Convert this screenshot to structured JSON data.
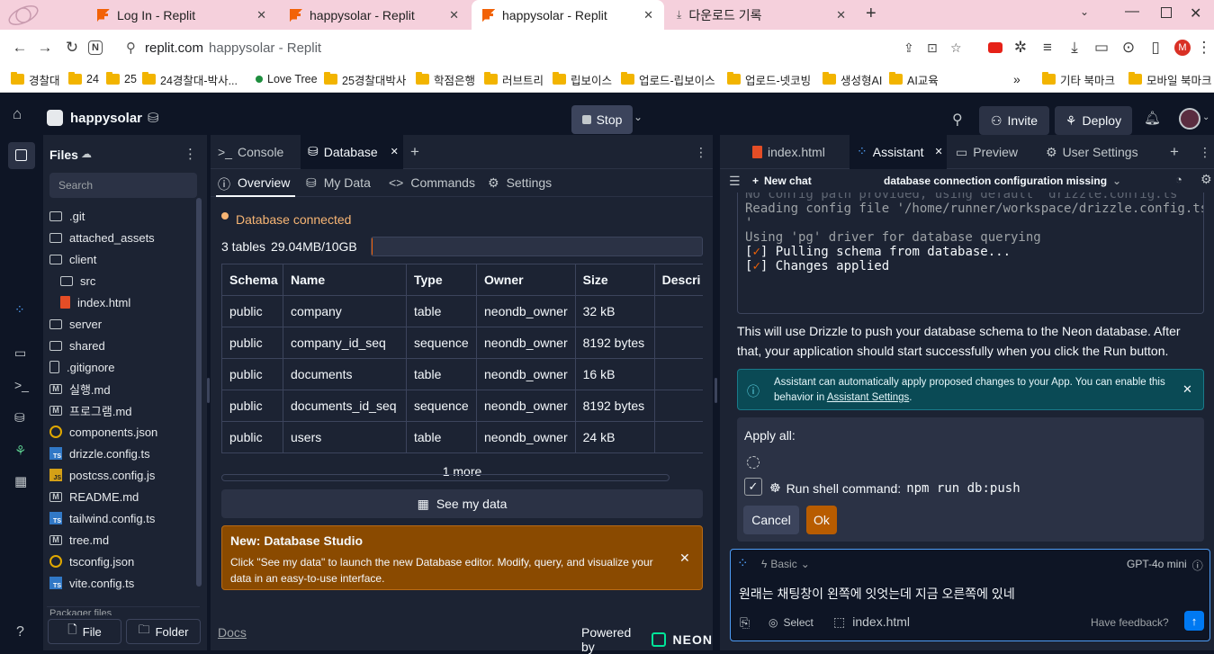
{
  "browser": {
    "tabs": [
      {
        "label": "Log In - Replit",
        "icon": "replit-icon"
      },
      {
        "label": "happysolar - Replit",
        "icon": "replit-icon"
      },
      {
        "label": "happysolar - Replit",
        "icon": "replit-icon",
        "active": true
      },
      {
        "label": "다운로드 기록",
        "icon": "download-icon"
      }
    ],
    "url_domain": "replit.com",
    "url_title": "happysolar - Replit",
    "profile_initial": "M",
    "bookmarks": [
      "경찰대",
      "24",
      "25",
      "24경찰대-박사...",
      "Love Tree",
      "25경찰대박사",
      "학점은행",
      "러브트리",
      "립보이스",
      "업로드-립보이스",
      "업로드-넷코빙",
      "생성형AI",
      "AI교육"
    ],
    "bookmarks_more": "»",
    "bookmarks_right": [
      "기타 북마크",
      "모바일 북마크"
    ]
  },
  "app": {
    "project_name": "happysolar",
    "stop_label": "Stop",
    "invite_label": "Invite",
    "deploy_label": "Deploy"
  },
  "files": {
    "title": "Files",
    "search_placeholder": "Search",
    "items": [
      {
        "name": ".git",
        "kind": "folder",
        "indent": 0
      },
      {
        "name": "attached_assets",
        "kind": "folder",
        "indent": 0
      },
      {
        "name": "client",
        "kind": "folder-open",
        "indent": 0
      },
      {
        "name": "src",
        "kind": "folder",
        "indent": 1
      },
      {
        "name": "index.html",
        "kind": "html",
        "indent": 1
      },
      {
        "name": "server",
        "kind": "folder",
        "indent": 0
      },
      {
        "name": "shared",
        "kind": "folder",
        "indent": 0
      },
      {
        "name": ".gitignore",
        "kind": "file",
        "indent": 0
      },
      {
        "name": "실행.md",
        "kind": "md",
        "indent": 0
      },
      {
        "name": "프로그램.md",
        "kind": "md",
        "indent": 0
      },
      {
        "name": "components.json",
        "kind": "json",
        "indent": 0
      },
      {
        "name": "drizzle.config.ts",
        "kind": "ts",
        "indent": 0
      },
      {
        "name": "postcss.config.js",
        "kind": "js",
        "indent": 0
      },
      {
        "name": "README.md",
        "kind": "md",
        "indent": 0
      },
      {
        "name": "tailwind.config.ts",
        "kind": "ts",
        "indent": 0
      },
      {
        "name": "tree.md",
        "kind": "md",
        "indent": 0
      },
      {
        "name": "tsconfig.json",
        "kind": "json",
        "indent": 0
      },
      {
        "name": "vite.config.ts",
        "kind": "ts",
        "indent": 0
      }
    ],
    "packager_label": "Packager files",
    "file_button": "File",
    "folder_button": "Folder"
  },
  "database": {
    "tabs": [
      "Console",
      "Database"
    ],
    "subtabs": [
      "Overview",
      "My Data",
      "Commands",
      "Settings"
    ],
    "status": "Database connected",
    "summary": "3 tables",
    "usage": "29.04MB/10GB",
    "usage_fraction": 0.003,
    "columns": [
      "Schema",
      "Name",
      "Type",
      "Owner",
      "Size",
      "Descri"
    ],
    "rows": [
      [
        "public",
        "company",
        "table",
        "neondb_owner",
        "32 kB",
        ""
      ],
      [
        "public",
        "company_id_seq",
        "sequence",
        "neondb_owner",
        "8192 bytes",
        ""
      ],
      [
        "public",
        "documents",
        "table",
        "neondb_owner",
        "16 kB",
        ""
      ],
      [
        "public",
        "documents_id_seq",
        "sequence",
        "neondb_owner",
        "8192 bytes",
        ""
      ],
      [
        "public",
        "users",
        "table",
        "neondb_owner",
        "24 kB",
        ""
      ]
    ],
    "more": "1 more",
    "see_data": "See my data",
    "banner_title": "New: Database Studio",
    "banner_text": "Click \"See my data\" to launch the new Database editor. Modify, query, and visualize your data in an easy-to-use interface.",
    "docs": "Docs",
    "powered_by": "Powered by",
    "neon": "NEON"
  },
  "assistant": {
    "tabs": [
      "index.html",
      "Assistant",
      "Preview",
      "User Settings"
    ],
    "new_chat": "New chat",
    "chat_title": "database connection configuration missing",
    "terminal_lines": [
      "No config path provided, using default 'drizzle.config.ts'",
      "Reading config file '/home/runner/workspace/drizzle.config.ts",
      "'",
      "Using 'pg' driver for database querying",
      "[✓] Pulling schema from database...",
      "[✓] Changes applied"
    ],
    "message": "This will use Drizzle to push your database schema to the Neon database. After that, your application should start successfully when you click the Run button.",
    "info_text": "Assistant can automatically apply proposed changes to your App. You can enable this behavior in ",
    "info_link": "Assistant Settings",
    "info_end": ".",
    "apply_all": "Apply all:",
    "run_label": "Run shell command:",
    "run_cmd": "npm run db:push",
    "cancel": "Cancel",
    "ok": "Ok",
    "mode": "Basic",
    "model": "GPT-4o mini",
    "input_text": "원래는 채팅창이 왼쪽에 잇엇는데 지금 오른쪽에 있네",
    "select_label": "Select",
    "context_file": "index.html",
    "feedback": "Have feedback?"
  },
  "colors": {
    "accent": "#f26207",
    "bg": "#0e1525",
    "panel": "#1c2333",
    "info": "#0a4a55",
    "warning": "#8a4a00"
  }
}
